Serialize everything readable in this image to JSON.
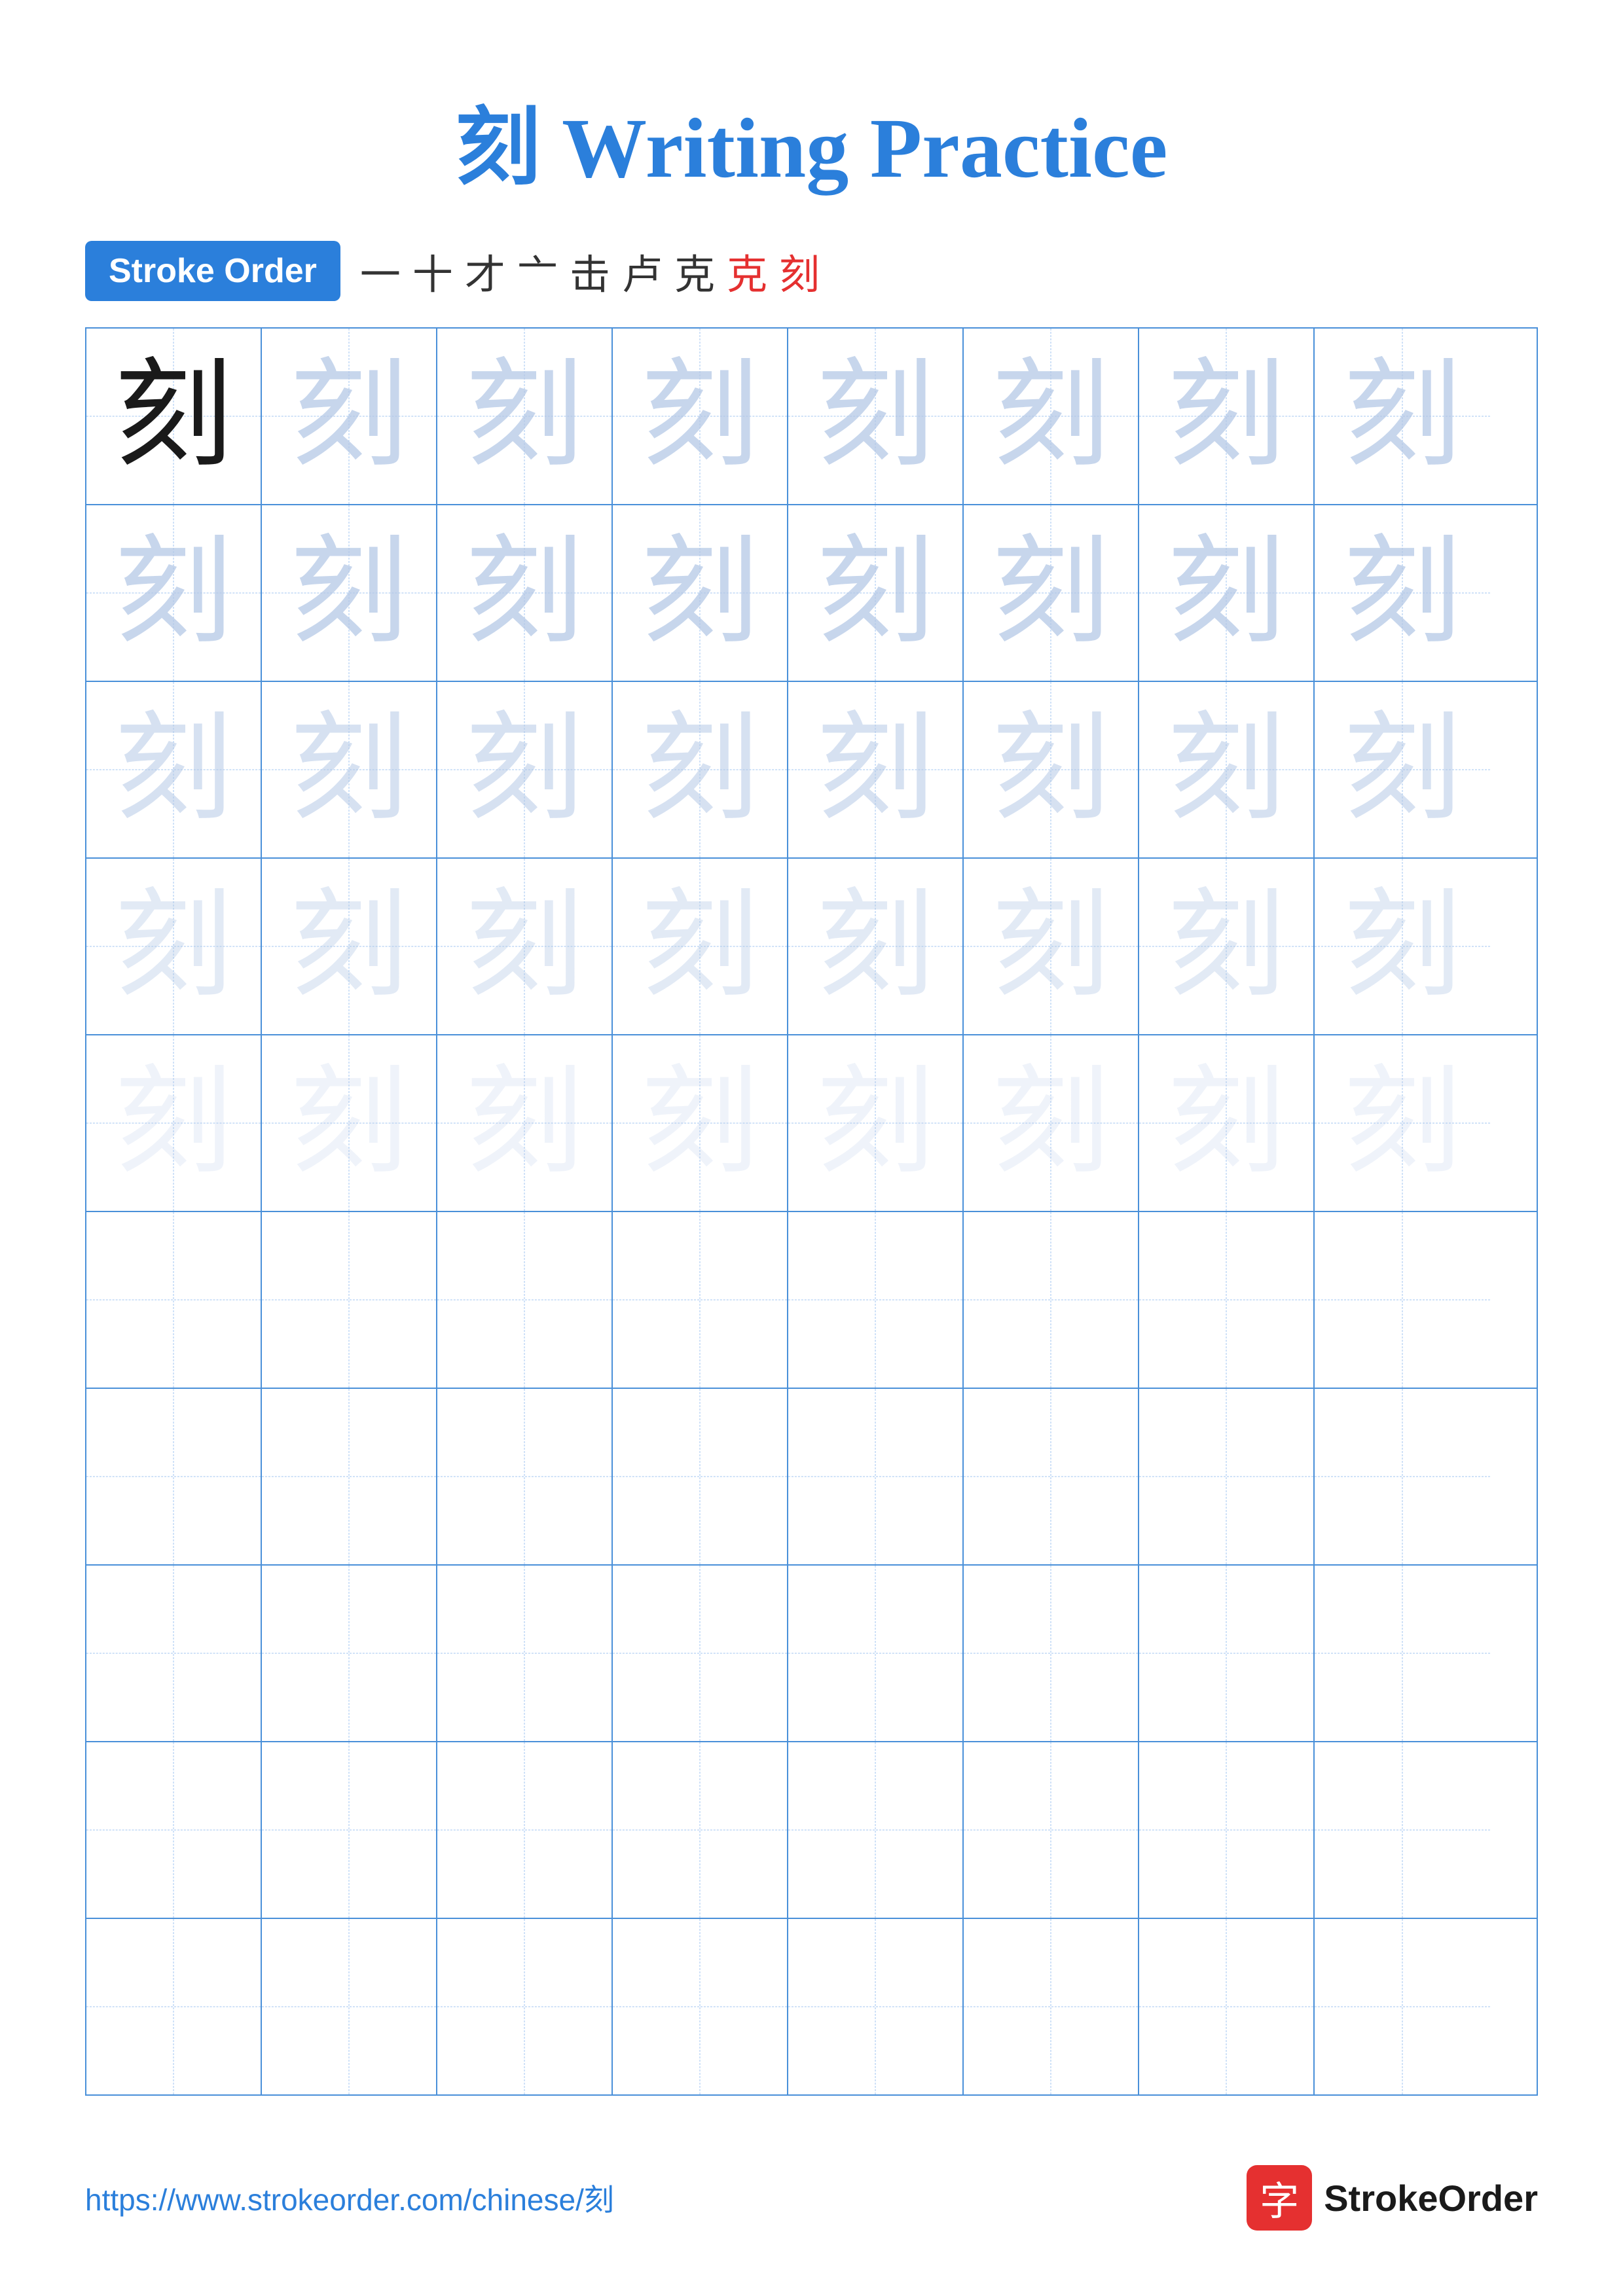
{
  "title": "刻 Writing Practice",
  "character": "刻",
  "stroke_order_label": "Stroke Order",
  "stroke_steps": [
    "一",
    "十",
    "才",
    "亠",
    "击",
    "卢",
    "克",
    "克",
    "刻"
  ],
  "stroke_steps_red_indices": [
    7,
    8
  ],
  "grid_rows": 10,
  "grid_cols": 8,
  "faded_rows": [
    {
      "row": 0,
      "style": "full"
    },
    {
      "row": 1,
      "style": "faded-1"
    },
    {
      "row": 2,
      "style": "faded-2"
    },
    {
      "row": 3,
      "style": "faded-3"
    },
    {
      "row": 4,
      "style": "faded-4"
    }
  ],
  "footer_url": "https://www.strokeorder.com/chinese/刻",
  "footer_logo_text": "StrokeOrder",
  "footer_logo_char": "字"
}
